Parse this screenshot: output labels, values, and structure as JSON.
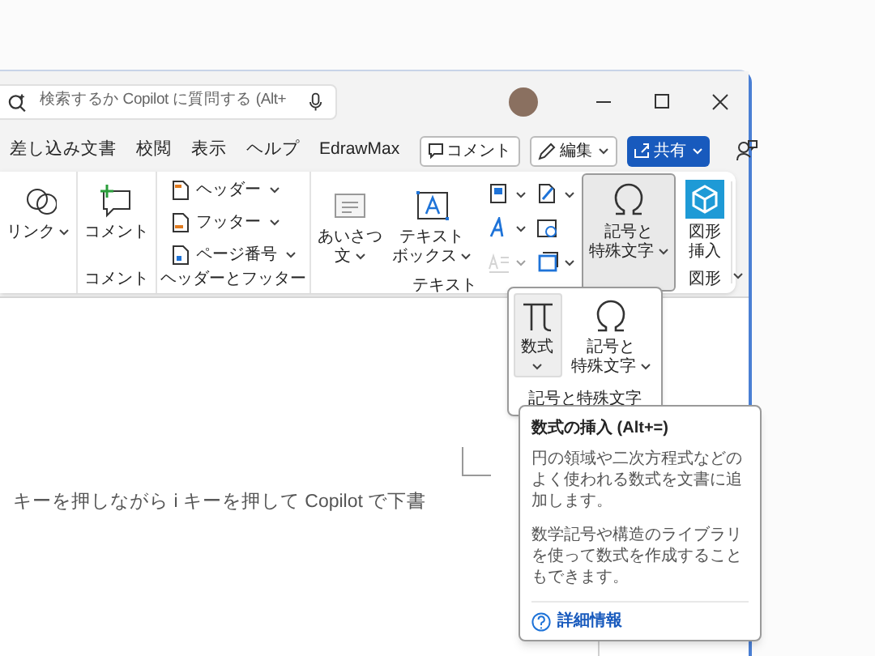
{
  "search": {
    "placeholder": "検索するか Copilot に質問する (Alt+"
  },
  "tabs": [
    {
      "label": "差し込み文書",
      "selected": false
    },
    {
      "label": "校閲",
      "selected": false
    },
    {
      "label": "表示",
      "selected": false
    },
    {
      "label": "ヘルプ",
      "selected": false
    },
    {
      "label": "EdrawMax",
      "selected": false
    }
  ],
  "header_buttons": [
    {
      "kind": "comment",
      "label": "コメント"
    },
    {
      "kind": "edit",
      "label": "編集"
    },
    {
      "kind": "share",
      "label": "共有"
    }
  ],
  "ribbon": {
    "groups": [
      {
        "items": [
          {
            "kind": "large",
            "label": [
              "リンク"
            ],
            "dropdown": true,
            "pressed": false
          }
        ]
      },
      {
        "label": "コメント",
        "items": [
          {
            "kind": "large",
            "label": [
              "コメント"
            ],
            "dropdown": false,
            "pressed": false
          }
        ]
      },
      {
        "label": "ヘッダーとフッター",
        "items": [
          {
            "kind": "small",
            "label": "ヘッダー",
            "dropdown": true,
            "pressed": false
          },
          {
            "kind": "small",
            "label": "フッター",
            "dropdown": true,
            "pressed": false
          },
          {
            "kind": "small",
            "label": "ページ番号",
            "dropdown": true,
            "pressed": false
          }
        ]
      },
      {
        "label": "テキスト",
        "items": [
          {
            "kind": "large",
            "label": [
              "あいさつ",
              "文"
            ],
            "dropdown": true,
            "pressed": false
          },
          {
            "kind": "large",
            "label": [
              "テキスト",
              "ボックス"
            ],
            "dropdown": true,
            "pressed": false
          },
          {
            "kind": "icon",
            "dropdown": true,
            "pressed": false,
            "disabled": false
          },
          {
            "kind": "icon",
            "dropdown": true,
            "pressed": false,
            "disabled": false
          },
          {
            "kind": "icon",
            "dropdown": true,
            "pressed": false,
            "disabled": true
          },
          {
            "kind": "icon",
            "dropdown": true,
            "pressed": false,
            "disabled": false
          },
          {
            "kind": "icon",
            "dropdown": false,
            "pressed": false,
            "disabled": false
          },
          {
            "kind": "icon",
            "dropdown": true,
            "pressed": false,
            "disabled": false
          }
        ]
      },
      {
        "items": [
          {
            "kind": "large",
            "label": [
              "記号と",
              "特殊文字"
            ],
            "dropdown": true,
            "pressed": true
          }
        ]
      },
      {
        "label": "図形",
        "items": [
          {
            "kind": "large",
            "label": [
              "図形",
              "挿入"
            ],
            "dropdown": false,
            "pressed": false
          }
        ]
      }
    ]
  },
  "dropdown": {
    "items": [
      {
        "label": [
          "数式"
        ],
        "dropdown": true,
        "hovered": true
      },
      {
        "label": [
          "記号と",
          "特殊文字"
        ],
        "dropdown": true,
        "hovered": false
      }
    ],
    "label": "記号と特殊文字"
  },
  "tooltip": {
    "title": "数式の挿入 (Alt+=)",
    "paragraphs": [
      "円の領域や二次方程式などのよく使われる数式を文書に追加します。",
      "数学記号や構造のライブラリを使って数式を作成することもできます。"
    ],
    "link": "詳細情報"
  },
  "document": {
    "text": "キーを押しながら i キーを押して Copilot で下書"
  }
}
